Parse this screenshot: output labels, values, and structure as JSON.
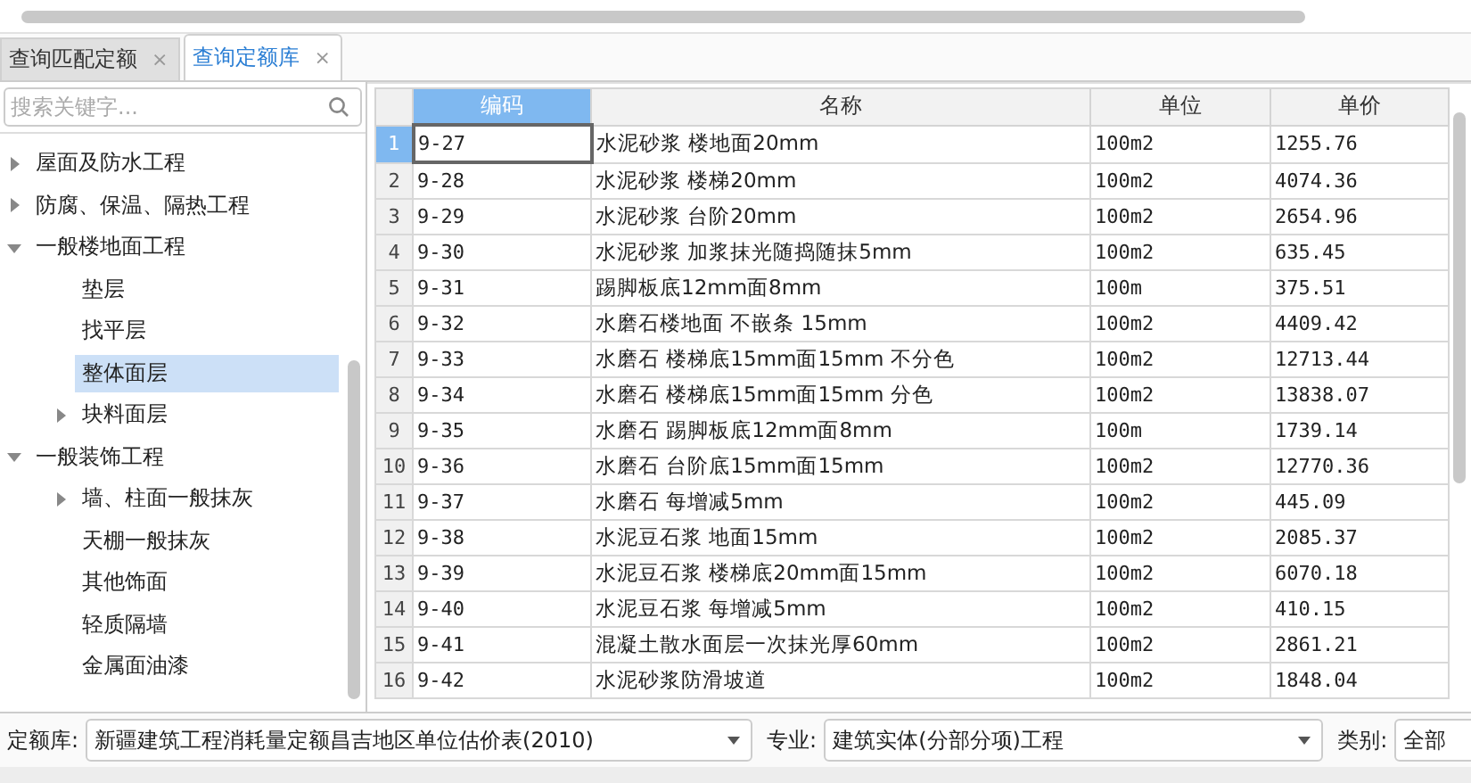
{
  "tabs": [
    {
      "label": "查询匹配定额",
      "selected": false,
      "close": "×"
    },
    {
      "label": "查询定额库",
      "selected": true,
      "close": "×"
    }
  ],
  "search": {
    "placeholder": "搜索关键字..."
  },
  "tree": [
    {
      "label": "屋面及防水工程",
      "expanded": false,
      "selected": false
    },
    {
      "label": "防腐、保温、隔热工程",
      "expanded": false,
      "selected": false
    },
    {
      "label": "一般楼地面工程",
      "expanded": true,
      "selected": false,
      "children": [
        {
          "label": "垫层",
          "selected": false
        },
        {
          "label": "找平层",
          "selected": false
        },
        {
          "label": "整体面层",
          "selected": true
        },
        {
          "label": "块料面层",
          "expanded": false,
          "selected": false
        }
      ]
    },
    {
      "label": "一般装饰工程",
      "expanded": true,
      "selected": false,
      "children": [
        {
          "label": "墙、柱面一般抹灰",
          "expanded": false,
          "selected": false
        },
        {
          "label": "天棚一般抹灰",
          "selected": false
        },
        {
          "label": "其他饰面",
          "selected": false
        },
        {
          "label": "轻质隔墙",
          "selected": false
        },
        {
          "label": "金属面油漆",
          "selected": false
        }
      ]
    }
  ],
  "table": {
    "columns": [
      {
        "label": "编码",
        "selected": true
      },
      {
        "label": "名称",
        "selected": false
      },
      {
        "label": "单位",
        "selected": false
      },
      {
        "label": "单价",
        "selected": false
      }
    ],
    "rows": [
      {
        "index": "1",
        "selected": true,
        "cells": [
          "9-27",
          "水泥砂浆 楼地面20mm",
          "100m2",
          "1255.76"
        ]
      },
      {
        "index": "2",
        "selected": false,
        "cells": [
          "9-28",
          "水泥砂浆 楼梯20mm",
          "100m2",
          "4074.36"
        ]
      },
      {
        "index": "3",
        "selected": false,
        "cells": [
          "9-29",
          "水泥砂浆 台阶20mm",
          "100m2",
          "2654.96"
        ]
      },
      {
        "index": "4",
        "selected": false,
        "cells": [
          "9-30",
          "水泥砂浆 加浆抹光随捣随抹5mm",
          "100m2",
          "635.45"
        ]
      },
      {
        "index": "5",
        "selected": false,
        "cells": [
          "9-31",
          "踢脚板底12mm面8mm",
          "100m",
          "375.51"
        ]
      },
      {
        "index": "6",
        "selected": false,
        "cells": [
          "9-32",
          "水磨石楼地面 不嵌条 15mm",
          "100m2",
          "4409.42"
        ]
      },
      {
        "index": "7",
        "selected": false,
        "cells": [
          "9-33",
          "水磨石 楼梯底15mm面15mm 不分色",
          "100m2",
          "12713.44"
        ]
      },
      {
        "index": "8",
        "selected": false,
        "cells": [
          "9-34",
          "水磨石 楼梯底15mm面15mm 分色",
          "100m2",
          "13838.07"
        ]
      },
      {
        "index": "9",
        "selected": false,
        "cells": [
          "9-35",
          "水磨石 踢脚板底12mm面8mm",
          "100m",
          "1739.14"
        ]
      },
      {
        "index": "10",
        "selected": false,
        "cells": [
          "9-36",
          "水磨石 台阶底15mm面15mm",
          "100m2",
          "12770.36"
        ]
      },
      {
        "index": "11",
        "selected": false,
        "cells": [
          "9-37",
          "水磨石 每增减5mm",
          "100m2",
          "445.09"
        ]
      },
      {
        "index": "12",
        "selected": false,
        "cells": [
          "9-38",
          "水泥豆石浆 地面15mm",
          "100m2",
          "2085.37"
        ]
      },
      {
        "index": "13",
        "selected": false,
        "cells": [
          "9-39",
          "水泥豆石浆 楼梯底20mm面15mm",
          "100m2",
          "6070.18"
        ]
      },
      {
        "index": "14",
        "selected": false,
        "cells": [
          "9-40",
          "水泥豆石浆 每增减5mm",
          "100m2",
          "410.15"
        ]
      },
      {
        "index": "15",
        "selected": false,
        "cells": [
          "9-41",
          "混凝土散水面层一次抹光厚60mm",
          "100m2",
          "2861.21"
        ]
      },
      {
        "index": "16",
        "selected": false,
        "cells": [
          "9-42",
          "水泥砂浆防滑坡道",
          "100m2",
          "1848.04"
        ]
      }
    ]
  },
  "filters": [
    {
      "label": "定额库:",
      "value": "新疆建筑工程消耗量定额昌吉地区单位估价表(2010)"
    },
    {
      "label": "专业:",
      "value": "建筑实体(分部分项)工程"
    },
    {
      "label": "类别:",
      "value": "全部"
    }
  ]
}
